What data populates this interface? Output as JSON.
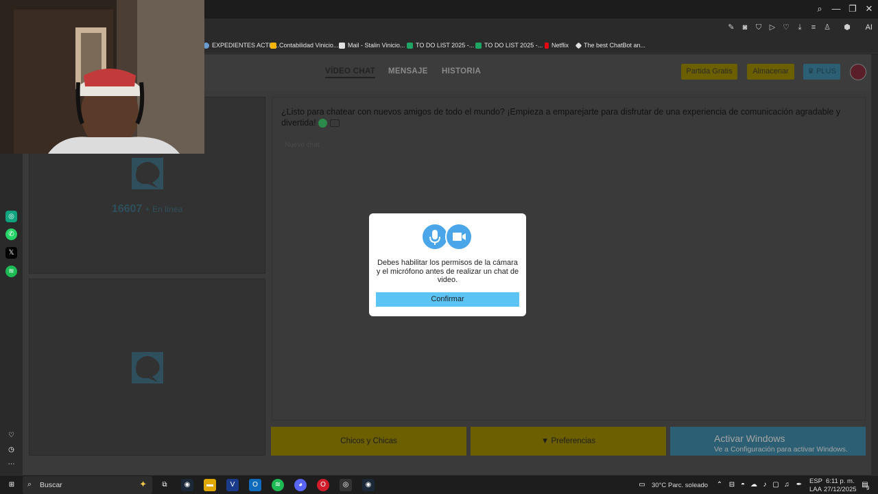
{
  "bookmarks": [
    {
      "label": "EXPEDIENTES ACTIV...",
      "icon": "globe-icon",
      "color": "#6b9bd1"
    },
    {
      "label": "Contabilidad Vinicio...",
      "icon": "drive-icon",
      "color": "#f5b400"
    },
    {
      "label": "Mail - Stalin Vinicio...",
      "icon": "document-icon",
      "color": "#e0e0e0"
    },
    {
      "label": "TO DO LIST 2025 -...",
      "icon": "sheets-icon",
      "color": "#1fa463"
    },
    {
      "label": "TO DO LIST 2025 -...",
      "icon": "sheets-icon",
      "color": "#1fa463"
    },
    {
      "label": "Netflix",
      "icon": "netflix-icon",
      "color": "#e50914"
    },
    {
      "label": "The best ChatBot an...",
      "icon": "chatbot-icon",
      "color": "#e0e0e0"
    }
  ],
  "browser": {
    "ai_label": "AI"
  },
  "nav": {
    "tabs": [
      {
        "label": "VÍDEO CHAT",
        "active": true
      },
      {
        "label": "MENSAJE",
        "active": false
      },
      {
        "label": "HISTORIA",
        "active": false
      }
    ],
    "partida_gratis": "Partida Gratis",
    "almacenar": "Almacenar",
    "plus": "PLUS"
  },
  "online": {
    "count": "16607",
    "label": "+ En línea"
  },
  "chat": {
    "message": "¿Listo para chatear con nuevos amigos de todo el mundo? ¡Empieza a emparejarte para disfrutar de una experiencia de comunicación agradable y divertida!",
    "hint": "Nuevo chat"
  },
  "bottom": {
    "gender": "Chicos y Chicas",
    "preferences": "Preferencias"
  },
  "watermark": {
    "title": "Activar Windows",
    "subtitle": "Ve a Configuración para activar Windows."
  },
  "modal": {
    "message": "Debes habilitar los permisos de la cámara y el micrófono antes de realizar un chat de video.",
    "confirm": "Confirmar"
  },
  "taskbar": {
    "search_label": "Buscar",
    "weather": "30°C",
    "weather_desc": "Parc. soleado",
    "lang_1": "ESP",
    "lang_2": "LAA",
    "time": "6:11 p. m.",
    "date": "27/12/2025",
    "notifications": "9"
  },
  "colors": {
    "accent_yellow": "#6b5f00",
    "accent_blue": "#2c7a94",
    "modal_button": "#5cc3f5"
  }
}
